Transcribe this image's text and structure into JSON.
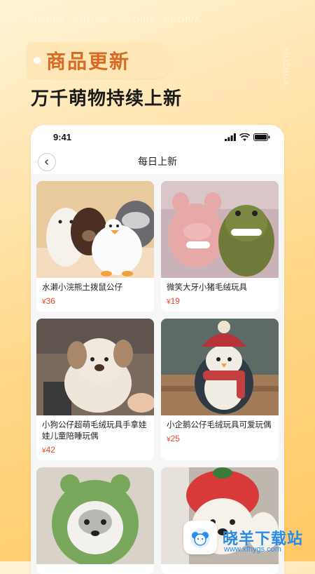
{
  "watermark": {
    "strip": "GUZHUA · GUZHUA · GUZHUA · GUZHUA",
    "side": "GUZHUA"
  },
  "banner": {
    "tag": "商品更新",
    "subtitle": "万千萌物持续上新"
  },
  "status_bar": {
    "time": "9:41"
  },
  "nav": {
    "title": "每日上新"
  },
  "products": [
    {
      "name": "水濑小浣熊土拨鼠公仔",
      "price": "36",
      "currency": "¥",
      "image": "plush-group-image"
    },
    {
      "name": "微笑大牙小猪毛绒玩具",
      "price": "19",
      "currency": "¥",
      "image": "pig-and-dino-plush-image"
    },
    {
      "name": "小狗公仔超萌毛绒玩具手拿娃娃儿童陪睡玩偶",
      "price": "42",
      "currency": "¥",
      "image": "puppy-plush-image"
    },
    {
      "name": "小企鹅公仔毛绒玩具可爱玩偶",
      "price": "25",
      "currency": "¥",
      "image": "penguin-plush-image"
    },
    {
      "name": "",
      "price": "",
      "currency": "",
      "image": "dino-hood-husky-plush-image"
    },
    {
      "name": "",
      "price": "",
      "currency": "",
      "image": "strawberry-hat-bear-plush-image"
    }
  ],
  "site_logo": {
    "text": "晓羊下载站",
    "url": "www.xfhygs.com"
  },
  "colors": {
    "accent": "#d86a22",
    "price": "#e8472b",
    "logo": "#2a8ce8"
  }
}
